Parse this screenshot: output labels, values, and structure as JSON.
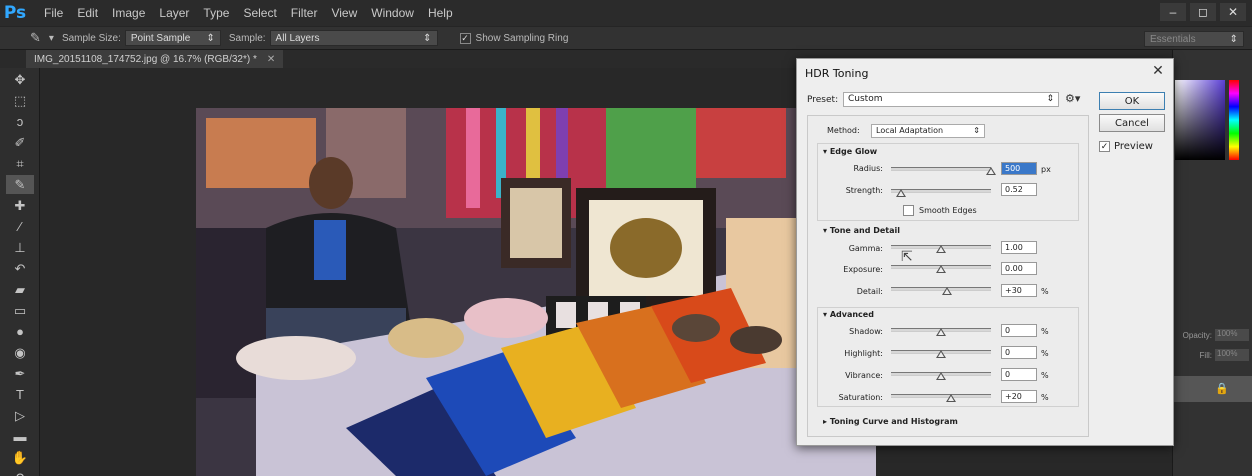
{
  "app": {
    "logo": "Ps",
    "menu": [
      "File",
      "Edit",
      "Image",
      "Layer",
      "Type",
      "Select",
      "Filter",
      "View",
      "Window",
      "Help"
    ],
    "window_controls": [
      "–",
      "◻",
      "✕"
    ]
  },
  "options_bar": {
    "sample_size_label": "Sample Size:",
    "sample_size_value": "Point Sample",
    "sample_label": "Sample:",
    "sample_value": "All Layers",
    "show_sampling_ring_label": "Show Sampling Ring",
    "show_sampling_ring_checked": true,
    "workspace": "Essentials"
  },
  "document": {
    "tab_title": "IMG_20151108_174752.jpg @ 16.7% (RGB/32*) *",
    "tab_close": "✕"
  },
  "right_panel": {
    "opacity_label": "Opacity:",
    "opacity_value": "100%",
    "fill_label": "Fill:",
    "fill_value": "100%"
  },
  "dialog": {
    "title": "HDR Toning",
    "close": "✕",
    "preset_label": "Preset:",
    "preset_value": "Custom",
    "ok_label": "OK",
    "cancel_label": "Cancel",
    "preview_label": "Preview",
    "preview_checked": true,
    "method_label": "Method:",
    "method_value": "Local Adaptation",
    "edge_glow": {
      "header": "Edge Glow",
      "radius_label": "Radius:",
      "radius_value": "500",
      "radius_unit": "px",
      "radius_pos": 1.0,
      "strength_label": "Strength:",
      "strength_value": "0.52",
      "strength_pos": 0.1,
      "smooth_edges_label": "Smooth Edges",
      "smooth_edges_checked": false
    },
    "tone_detail": {
      "header": "Tone and Detail",
      "gamma_label": "Gamma:",
      "gamma_value": "1.00",
      "gamma_pos": 0.5,
      "exposure_label": "Exposure:",
      "exposure_value": "0.00",
      "exposure_pos": 0.5,
      "detail_label": "Detail:",
      "detail_value": "+30",
      "detail_unit": "%",
      "detail_pos": 0.56
    },
    "advanced": {
      "header": "Advanced",
      "shadow_label": "Shadow:",
      "shadow_value": "0",
      "highlight_label": "Highlight:",
      "highlight_value": "0",
      "vibrance_label": "Vibrance:",
      "vibrance_value": "0",
      "saturation_label": "Saturation:",
      "saturation_value": "+20",
      "unit": "%",
      "shadow_pos": 0.5,
      "highlight_pos": 0.5,
      "vibrance_pos": 0.5,
      "saturation_pos": 0.6
    },
    "toning_curve_header": "Toning Curve and Histogram"
  },
  "colors": {
    "accent": "#31a8ff",
    "selected_field": "#3a78c9"
  }
}
